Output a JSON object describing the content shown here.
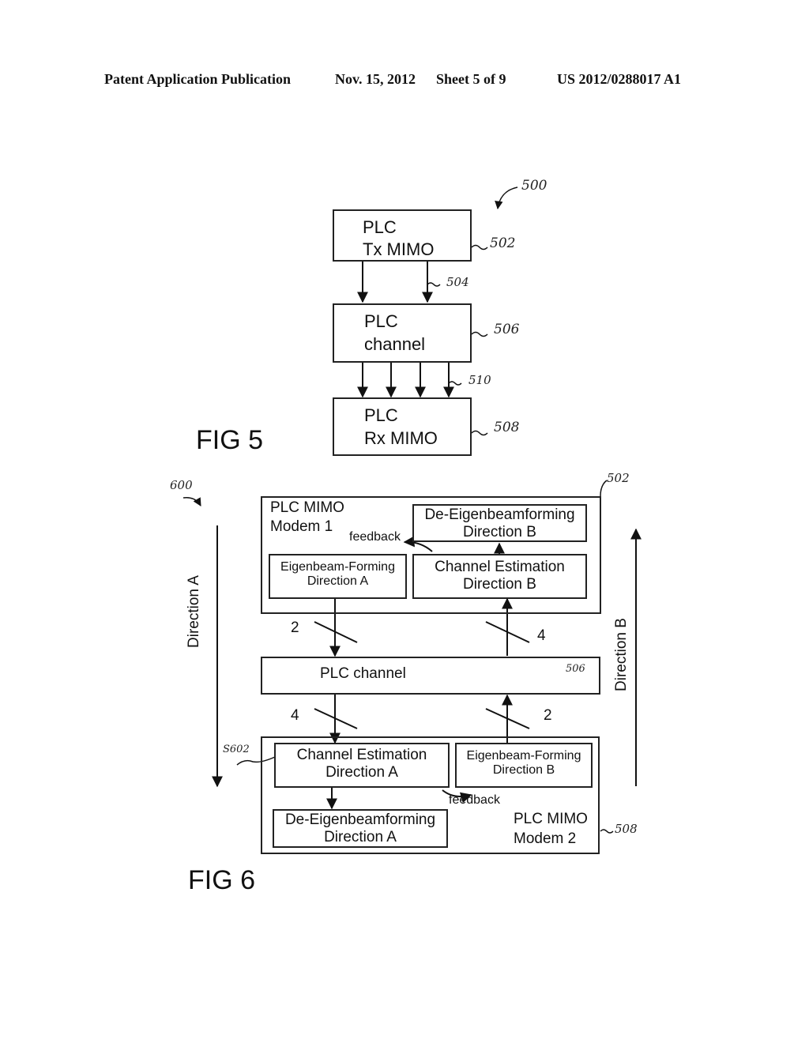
{
  "header": {
    "left": "Patent Application Publication",
    "date": "Nov. 15, 2012",
    "sheet": "Sheet 5 of 9",
    "number": "US 2012/0288017 A1"
  },
  "fig5": {
    "label": "FIG 5",
    "ref": "500",
    "tx": {
      "line1": "PLC",
      "line2": "Tx MIMO",
      "ref": "502"
    },
    "link_tx": {
      "ref": "504",
      "lines": 2
    },
    "channel": {
      "line1": "PLC",
      "line2": "channel",
      "ref": "506"
    },
    "link_rx": {
      "ref": "510",
      "lines": 4
    },
    "rx": {
      "line1": "PLC",
      "line2": "Rx MIMO",
      "ref": "508"
    }
  },
  "fig6": {
    "label": "FIG 6",
    "ref": "600",
    "direction_a": "Direction A",
    "direction_b": "Direction B",
    "modem1": {
      "title1": "PLC MIMO",
      "title2": "Modem 1",
      "ref": "502",
      "deeigen_b": {
        "line1": "De-Eigenbeamforming",
        "line2": "Direction B"
      },
      "eigen_a": {
        "line1": "Eigenbeam-Forming",
        "line2": "Direction A"
      },
      "chest_b": {
        "line1": "Channel Estimation",
        "line2": "Direction B"
      },
      "feedback": "feedback"
    },
    "channel": {
      "label": "PLC channel",
      "ref": "506"
    },
    "bus_counts": {
      "a_top": "2",
      "b_top": "4",
      "a_bottom": "4",
      "b_bottom": "2"
    },
    "modem2": {
      "title1": "PLC MIMO",
      "title2": "Modem 2",
      "ref": "508",
      "sub_ref": "S602",
      "chest_a": {
        "line1": "Channel Estimation",
        "line2": "Direction A"
      },
      "eigen_b": {
        "line1": "Eigenbeam-Forming",
        "line2": "Direction B"
      },
      "deeigen_a": {
        "line1": "De-Eigenbeamforming",
        "line2": "Direction A"
      },
      "feedback": "feedback"
    }
  }
}
